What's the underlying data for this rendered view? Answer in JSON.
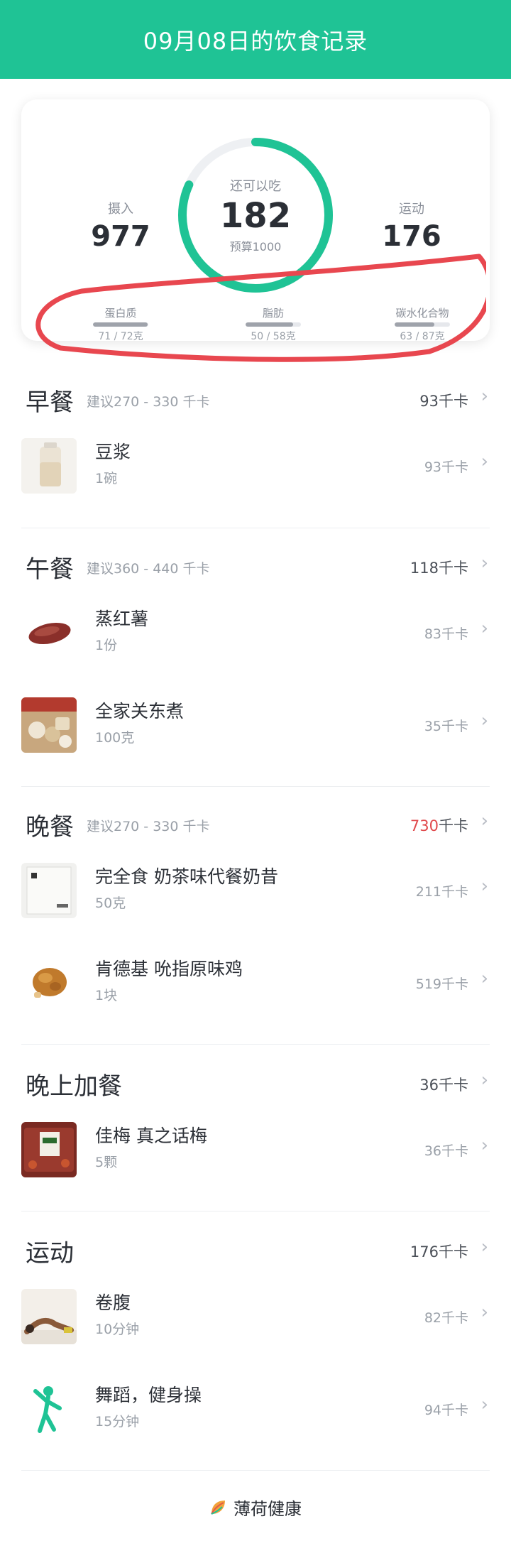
{
  "header": {
    "title": "09月08日的饮食记录"
  },
  "summary": {
    "intake_label": "摄入",
    "intake_value": "977",
    "remaining_label": "还可以吃",
    "remaining_value": "182",
    "budget_label": "预算1000",
    "exercise_label": "运动",
    "exercise_value": "176",
    "ring_progress": 0.818,
    "accent_color": "#1fc395",
    "macros": [
      {
        "name": "蛋白质",
        "value": "71 / 72克",
        "fill": 0.99
      },
      {
        "name": "脂肪",
        "value": "50 / 58克",
        "fill": 0.86
      },
      {
        "name": "碳水化合物",
        "value": "63 / 87克",
        "fill": 0.72
      }
    ]
  },
  "sections": [
    {
      "title": "早餐",
      "hint": "建议270 - 330 千卡",
      "total": "93千卡",
      "items": [
        {
          "name": "豆浆",
          "qty": "1碗",
          "kcal": "93千卡",
          "icon": "soy-milk-thumbnail"
        }
      ]
    },
    {
      "title": "午餐",
      "hint": "建议360 - 440 千卡",
      "total": "118千卡",
      "items": [
        {
          "name": "蒸红薯",
          "qty": "1份",
          "kcal": "83千卡",
          "icon": "sweet-potato-thumbnail"
        },
        {
          "name": "全家关东煮",
          "qty": "100克",
          "kcal": "35千卡",
          "icon": "oden-thumbnail"
        }
      ]
    },
    {
      "title": "晚餐",
      "hint": "建议270 - 330 千卡",
      "total_number": "730",
      "total_unit": "千卡",
      "items": [
        {
          "name": "完全食 奶茶味代餐奶昔",
          "qty": "50克",
          "kcal": "211千卡",
          "icon": "shake-package-thumbnail"
        },
        {
          "name": "肯德基 吮指原味鸡",
          "qty": "1块",
          "kcal": "519千卡",
          "icon": "fried-chicken-thumbnail"
        }
      ]
    },
    {
      "title": "晚上加餐",
      "total": "36千卡",
      "items": [
        {
          "name": "佳梅 真之话梅",
          "qty": "5颗",
          "kcal": "36千卡",
          "icon": "plum-snack-thumbnail"
        }
      ]
    },
    {
      "title": "运动",
      "total": "176千卡",
      "items": [
        {
          "name": "卷腹",
          "qty": "10分钟",
          "kcal": "82千卡",
          "icon": "crunch-thumbnail"
        },
        {
          "name": "舞蹈，健身操",
          "qty": "15分钟",
          "kcal": "94千卡",
          "icon": "dance-figure-icon"
        }
      ]
    }
  ],
  "footer": {
    "brand": "薄荷健康"
  },
  "chevron": "›",
  "annotation_color": "#e8474f"
}
